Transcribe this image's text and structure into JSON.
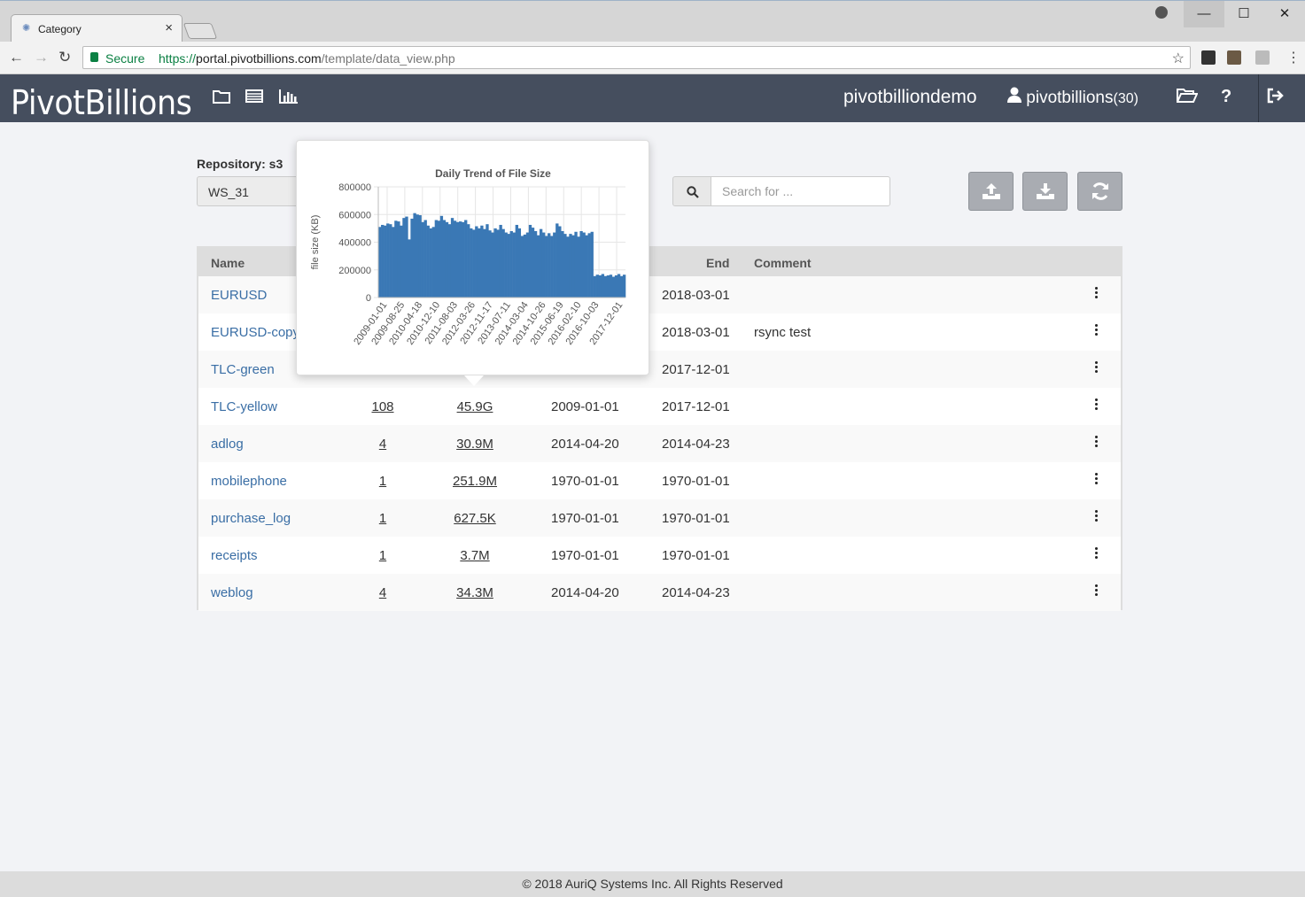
{
  "browser": {
    "tab_title": "Category",
    "secure_label": "Secure",
    "url_scheme": "https://",
    "url_host": "portal.pivotbillions.com",
    "url_path": "/template/data_view.php"
  },
  "header": {
    "logo": "PivotBillions",
    "user": "pivotbilliondemo",
    "account": "pivotbillions",
    "account_count": "(30)"
  },
  "toolbar": {
    "repository_label": "Repository: s3",
    "workspace": "WS_31",
    "search_placeholder": "Search for ..."
  },
  "table": {
    "headers": {
      "name": "Name",
      "end": "End",
      "comment": "Comment"
    },
    "rows": [
      {
        "name": "EURUSD",
        "files": "",
        "size": "",
        "start": "",
        "end": "2018-03-01",
        "comment": ""
      },
      {
        "name": "EURUSD-copy",
        "files": "",
        "size": "",
        "start": "",
        "end": "2018-03-01",
        "comment": "rsync test"
      },
      {
        "name": "TLC-green",
        "files": "",
        "size": "",
        "start": "",
        "end": "2017-12-01",
        "comment": ""
      },
      {
        "name": "TLC-yellow",
        "files": "108",
        "size": "45.9G",
        "start": "2009-01-01",
        "end": "2017-12-01",
        "comment": ""
      },
      {
        "name": "adlog",
        "files": "4",
        "size": "30.9M",
        "start": "2014-04-20",
        "end": "2014-04-23",
        "comment": ""
      },
      {
        "name": "mobilephone",
        "files": "1",
        "size": "251.9M",
        "start": "1970-01-01",
        "end": "1970-01-01",
        "comment": ""
      },
      {
        "name": "purchase_log",
        "files": "1",
        "size": "627.5K",
        "start": "1970-01-01",
        "end": "1970-01-01",
        "comment": ""
      },
      {
        "name": "receipts",
        "files": "1",
        "size": "3.7M",
        "start": "1970-01-01",
        "end": "1970-01-01",
        "comment": ""
      },
      {
        "name": "weblog",
        "files": "4",
        "size": "34.3M",
        "start": "2014-04-20",
        "end": "2014-04-23",
        "comment": ""
      }
    ]
  },
  "footer": {
    "copyright": "© 2018 AuriQ Systems Inc. All Rights Reserved"
  },
  "colors": {
    "header_bg": "#454e5e",
    "bar": "#3a78b5",
    "link": "#3a6ea5"
  },
  "chart_data": {
    "type": "bar",
    "title": "Daily Trend of File Size",
    "xlabel": "",
    "ylabel": "file size (KB)",
    "ylim": [
      0,
      800000
    ],
    "yticks": [
      0,
      200000,
      400000,
      600000,
      800000
    ],
    "xticks": [
      "2009-01-01",
      "2009-08-25",
      "2010-04-18",
      "2010-12-10",
      "2011-08-03",
      "2012-03-26",
      "2012-11-17",
      "2013-07-11",
      "2014-03-04",
      "2014-10-26",
      "2015-06-19",
      "2016-02-10",
      "2016-10-03",
      "2017-12-01"
    ],
    "grid": true,
    "values": [
      510000,
      525000,
      520000,
      535000,
      530000,
      510000,
      555000,
      550000,
      520000,
      575000,
      585000,
      420000,
      570000,
      610000,
      600000,
      595000,
      545000,
      560000,
      520000,
      500000,
      510000,
      560000,
      555000,
      590000,
      560000,
      545000,
      530000,
      575000,
      555000,
      545000,
      550000,
      545000,
      560000,
      530000,
      500000,
      490000,
      515000,
      500000,
      520000,
      495000,
      530000,
      485000,
      470000,
      500000,
      490000,
      525000,
      495000,
      470000,
      460000,
      480000,
      470000,
      525000,
      500000,
      445000,
      455000,
      470000,
      525000,
      505000,
      480000,
      450000,
      495000,
      470000,
      445000,
      465000,
      445000,
      470000,
      535000,
      515000,
      480000,
      460000,
      440000,
      460000,
      450000,
      475000,
      440000,
      480000,
      470000,
      450000,
      465000,
      475000,
      155000,
      165000,
      160000,
      170000,
      155000,
      160000,
      165000,
      150000,
      160000,
      170000,
      155000,
      165000
    ]
  }
}
